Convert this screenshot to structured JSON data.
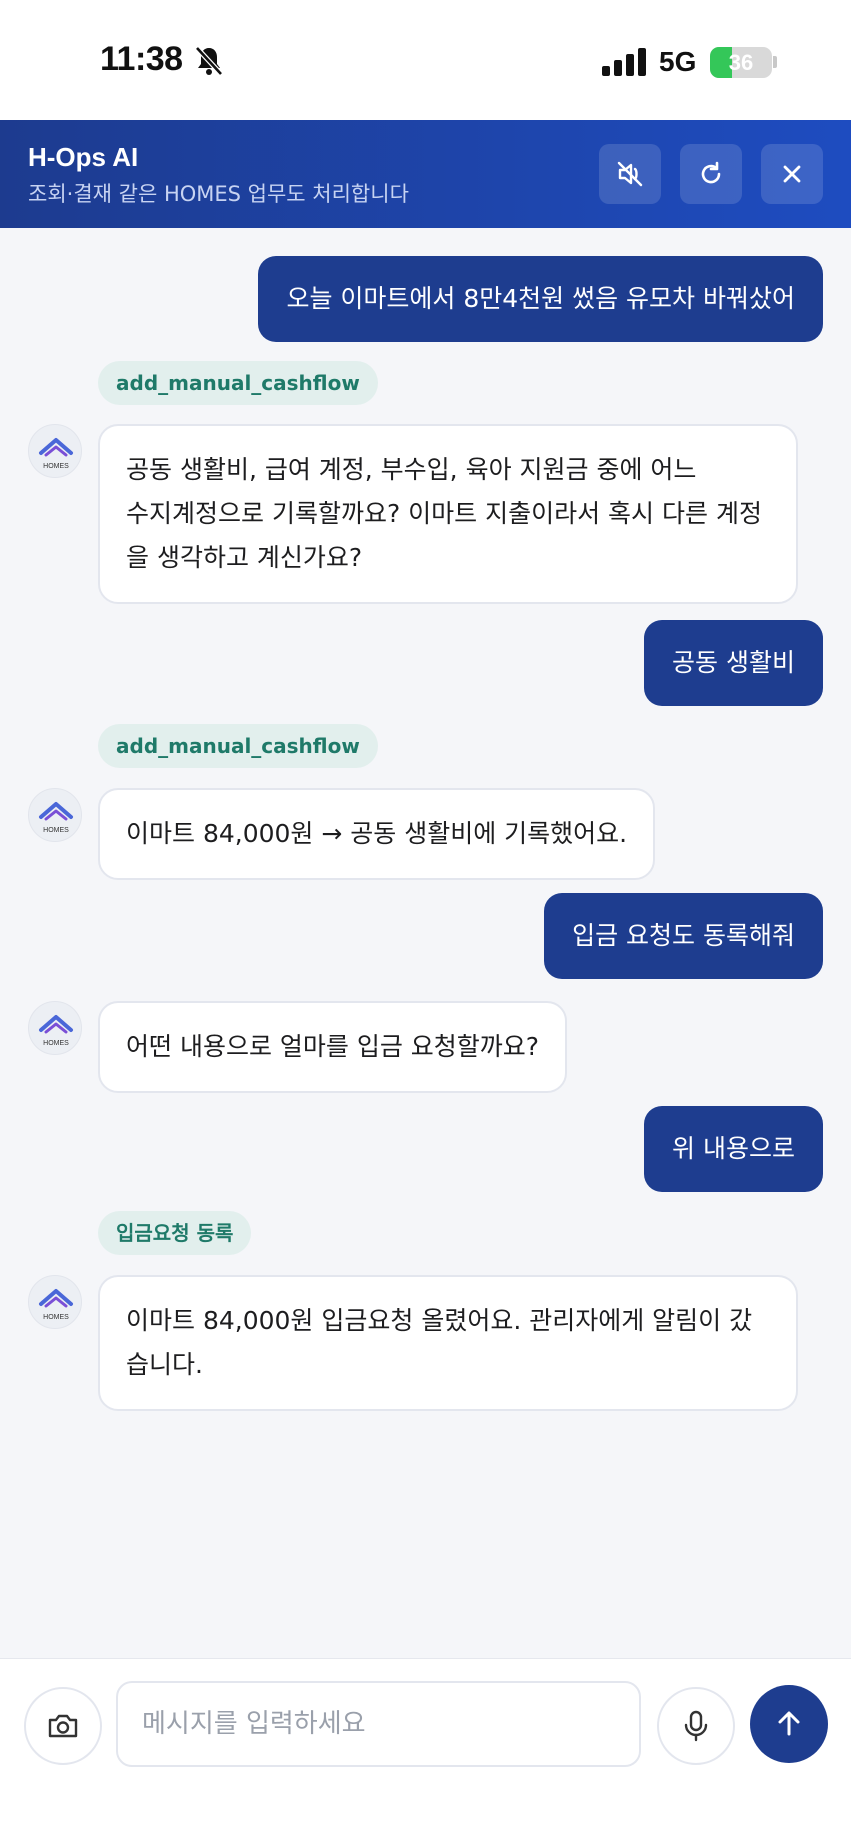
{
  "status_bar": {
    "time": "11:38",
    "network": "5G",
    "battery": "36",
    "battery_level": 0.36
  },
  "header": {
    "title": "H-Ops AI",
    "subtitle": "조회·결재 같은 HOMES 업무도 처리합니다"
  },
  "header_icons": {
    "mute": "speaker-muted-icon",
    "refresh": "refresh-icon",
    "close": "close-icon"
  },
  "bot_avatar_label": "HOMES",
  "messages": [
    {
      "role": "user",
      "text": "오늘 이마트에서 8만4천원 썼음 유모차 바꿔샀어"
    },
    {
      "role": "tool",
      "text": "add_manual_cashflow"
    },
    {
      "role": "bot",
      "lines": [
        "공동 생활비, 급여 계정, 부수입, 육아 지원금 중에 어느",
        "수지계정으로 기록할까요? 이마트 지출이라서 혹시 다른 계정",
        "을 생각하고 계신가요?"
      ]
    },
    {
      "role": "user",
      "text": "공동 생활비"
    },
    {
      "role": "tool",
      "text": "add_manual_cashflow"
    },
    {
      "role": "bot",
      "lines": [
        "이마트 84,000원 → 공동 생활비에 기록했어요."
      ]
    },
    {
      "role": "user",
      "text": "입금 요청도 동록해줘"
    },
    {
      "role": "bot",
      "lines": [
        "어떤 내용으로 얼마를 입금 요청할까요?"
      ]
    },
    {
      "role": "user",
      "text": "위 내용으로"
    },
    {
      "role": "tool",
      "text": "입금요청 동록"
    },
    {
      "role": "bot",
      "lines": [
        "이마트 84,000원 입금요청 올렸어요. 관리자에게 알림이 갔",
        "습니다."
      ]
    }
  ],
  "composer": {
    "placeholder": "메시지를 입력하세요",
    "value": ""
  },
  "colors": {
    "accent": "#1e3d8f",
    "header_start": "#1d3b8f",
    "header_end": "#1e4cc0",
    "chip_bg": "#e2efed",
    "chip_text": "#1f7a69"
  }
}
